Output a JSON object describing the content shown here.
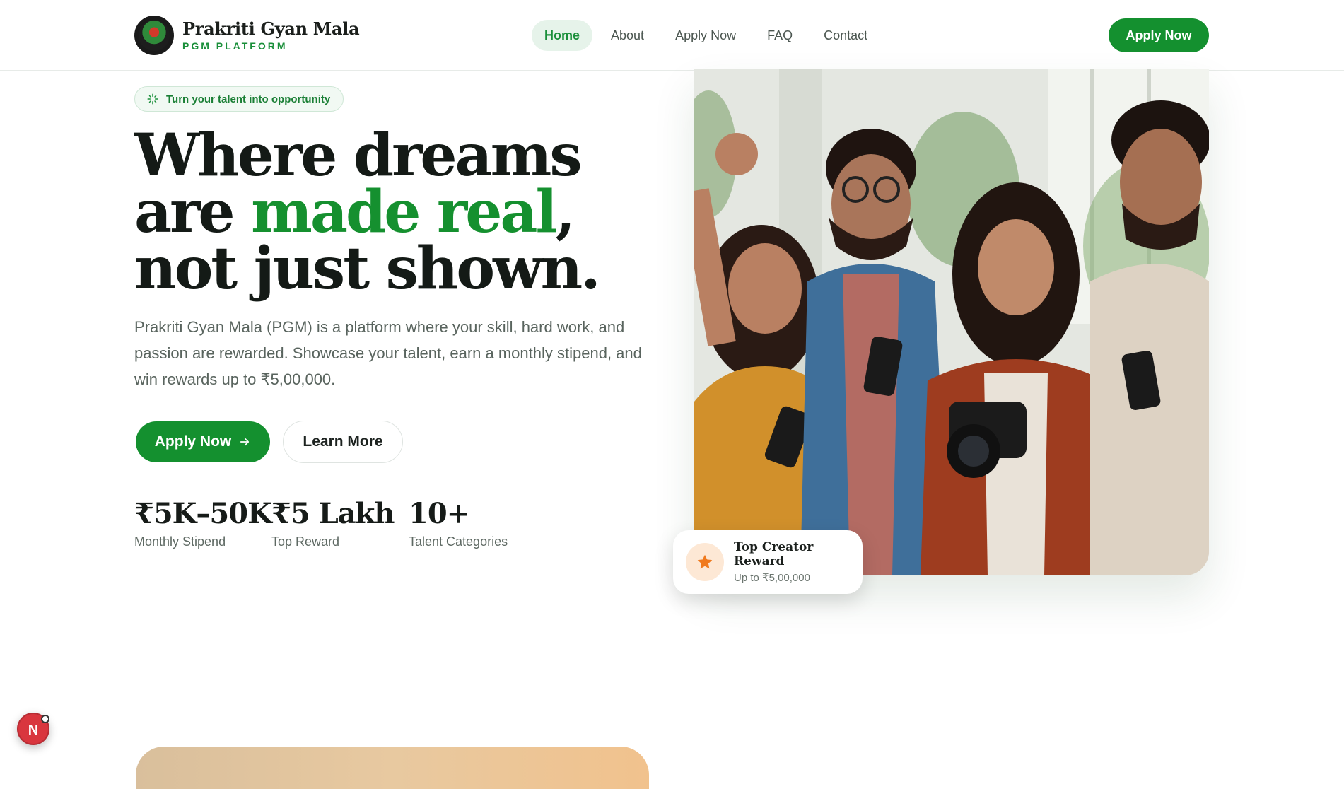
{
  "header": {
    "brand_name": "Prakriti Gyan Mala",
    "brand_tagline": "PGM PLATFORM",
    "nav": [
      {
        "label": "Home",
        "active": true
      },
      {
        "label": "About",
        "active": false
      },
      {
        "label": "Apply Now",
        "active": false
      },
      {
        "label": "FAQ",
        "active": false
      },
      {
        "label": "Contact",
        "active": false
      }
    ],
    "cta_label": "Apply Now"
  },
  "hero": {
    "badge_text": "Turn your talent into opportunity",
    "headline": {
      "line1": "Where dreams",
      "line2_start": "are ",
      "line2_accent": "made real",
      "line2_end": ",",
      "line3": "not just shown."
    },
    "lead": "Prakriti Gyan Mala (PGM) is a platform where your skill, hard work, and passion are rewarded. Showcase your talent, earn a monthly stipend, and win rewards up to ₹5,00,000.",
    "primary_button": "Apply Now",
    "primary_button_icon": "arrow-right-icon",
    "secondary_button": "Learn More",
    "stats": [
      {
        "value": "₹5K–50K",
        "label": "Monthly Stipend"
      },
      {
        "value": "₹5 Lakh",
        "label": "Top Reward"
      },
      {
        "value": "10+",
        "label": "Talent Categories"
      }
    ]
  },
  "reward_card": {
    "icon": "star-icon",
    "title": "Top Creator Reward",
    "subtitle": "Up to ₹5,00,000"
  },
  "floating_avatar": {
    "letter": "N"
  },
  "colors": {
    "brand_green": "#14902f",
    "accent_green": "#15902f",
    "active_nav_bg": "#e6f3ea",
    "star_orange": "#f07a1e",
    "heading_dark": "#141a16"
  }
}
